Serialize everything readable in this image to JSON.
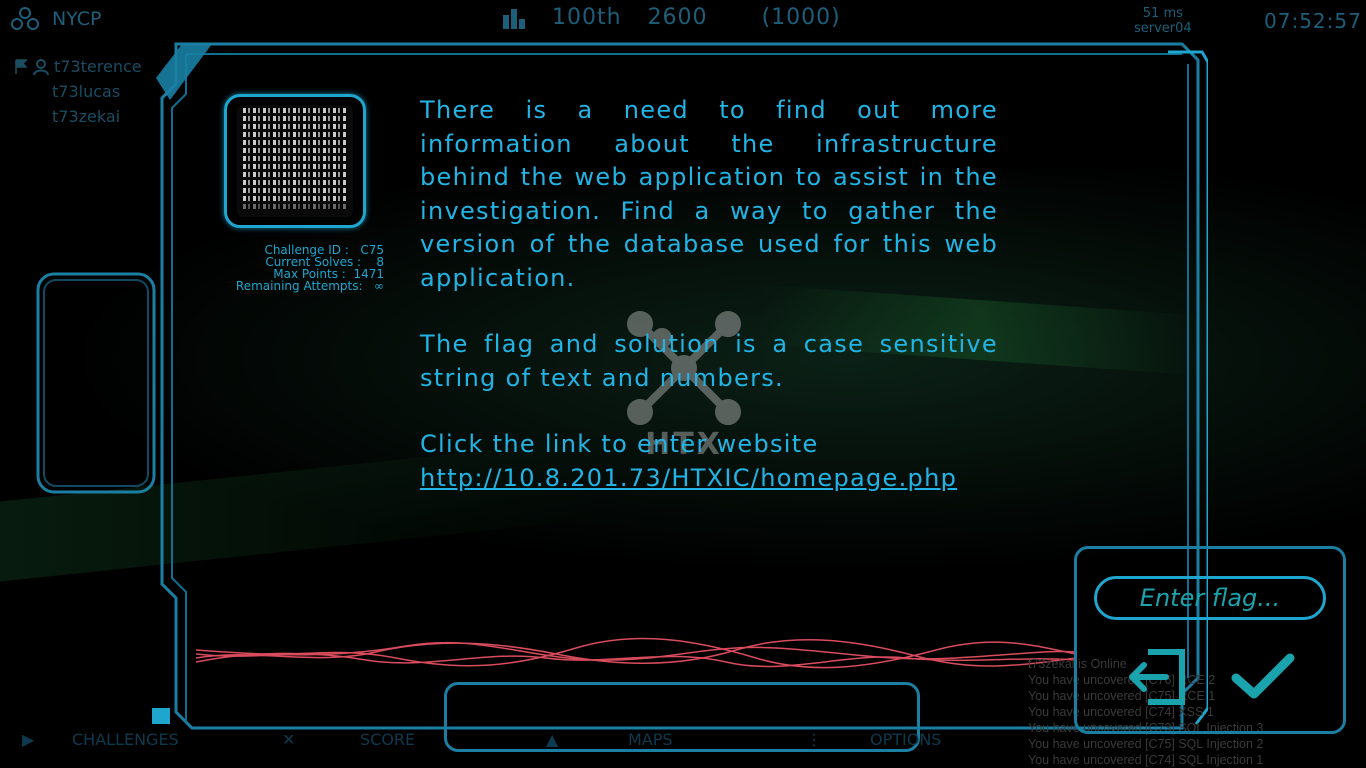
{
  "colors": {
    "accent": "#1ea6cf",
    "text": "#22b4e4",
    "dim": "#1d5f7a",
    "wave": "#ff5a6e",
    "check": "#1aa3ad"
  },
  "topbar": {
    "team_icon": "team-icon",
    "team_name": "NYCP",
    "rank": "100th",
    "score": "2600",
    "bonus": "(1000)",
    "ping": "51 ms",
    "server": "server04",
    "clock": "07:52:57"
  },
  "members": [
    "t73terence",
    "t73lucas",
    "t73zekai"
  ],
  "challenge": {
    "id_label": "Challenge ID :",
    "id_value": "C75",
    "solves_label": "Current Solves :",
    "solves_value": "8",
    "points_label": "Max Points   :",
    "points_value": "1471",
    "attempts_label": "Remaining Attempts:",
    "attempts_value": "∞",
    "description": "There is a need to find out more information about the infrastructure behind the  web application to assist in the investigation. Find a way  to gather the version of the database used for this web application.",
    "note": "The flag and solution is a case sensitive string of text and numbers.",
    "link_intro": "Click the link to enter website",
    "link": "http://10.8.201.73/HTXIC/homepage.php"
  },
  "logo_text": "HTX",
  "flag": {
    "placeholder": "Enter flag..."
  },
  "nav": {
    "challenges": "CHALLENGES",
    "score": "SCORE",
    "maps": "MAPS",
    "options": "OPTIONS"
  },
  "log": [
    "t73zekai is Online",
    "You have uncovered [C76] RCE 2",
    "You have uncovered [C75] RCE 1",
    "You have uncovered [C74] XSS 1",
    "You have uncovered [C73] SQL Injection 3",
    "You have uncovered [C75] SQL Injection 2",
    "You have uncovered [C74] SQL Injection 1"
  ]
}
